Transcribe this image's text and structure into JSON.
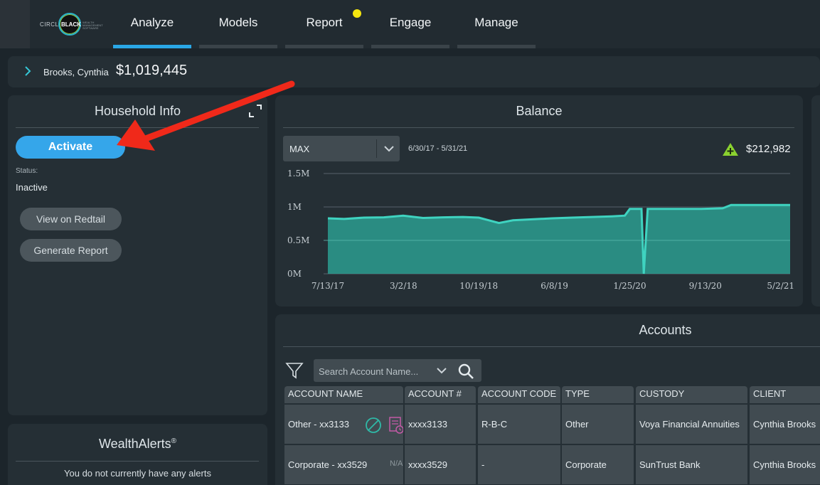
{
  "nav": {
    "logo": {
      "left": "CIRCLE",
      "mid": "BLACK",
      "tagline": "WEALTH MANAGEMENT SOFTWARE"
    },
    "tabs": [
      "Analyze",
      "Models",
      "Report",
      "Engage",
      "Manage"
    ],
    "active_tab": "Analyze",
    "notification_color": "#f5e60f"
  },
  "client": {
    "name": "Brooks, Cynthia",
    "total": "$1,019,445"
  },
  "household": {
    "title": "Household Info",
    "activate_label": "Activate",
    "status_label": "Status:",
    "status_value": "Inactive",
    "view_redtail_label": "View on Redtail",
    "generate_report_label": "Generate Report"
  },
  "wealth_alerts": {
    "title": "WealthAlerts",
    "trademark": "®",
    "message": "You do not currently have any alerts"
  },
  "balance": {
    "title": "Balance",
    "range_value": "MAX",
    "date_range": "6/30/17 - 5/31/21",
    "change_value": "$212,982",
    "change_direction": "up"
  },
  "chart_data": {
    "type": "area",
    "title": "Balance",
    "y_ticks": [
      "1.5M",
      "1M",
      "0.5M",
      "0M"
    ],
    "x_ticks": [
      "7/13/17",
      "3/2/18",
      "10/19/18",
      "6/8/19",
      "1/25/20",
      "9/13/20",
      "5/2/21"
    ],
    "ylim": [
      0,
      1500000
    ],
    "series": [
      {
        "x": [
          "7/13/17",
          "9/1/17",
          "11/1/17",
          "1/1/18",
          "3/1/18",
          "5/1/18",
          "7/1/18",
          "9/1/18",
          "10/19/18",
          "12/20/18",
          "2/1/19",
          "4/1/19",
          "6/1/19",
          "8/1/19",
          "10/1/19",
          "12/1/19",
          "1/10/20",
          "1/25/20",
          "3/1/20",
          "3/8/20",
          "3/20/20",
          "6/1/20",
          "9/1/20",
          "11/5/20",
          "12/1/20",
          "3/1/21",
          "5/31/21"
        ],
        "values": [
          830000,
          820000,
          840000,
          845000,
          870000,
          835000,
          845000,
          850000,
          840000,
          760000,
          800000,
          815000,
          830000,
          840000,
          850000,
          860000,
          870000,
          970000,
          970000,
          0,
          970000,
          970000,
          970000,
          980000,
          1030000,
          1030000,
          1030000
        ]
      }
    ],
    "grid": true,
    "colors": {
      "fill": "#2b9c8f",
      "line": "#3fd3c0"
    }
  },
  "accounts": {
    "title": "Accounts",
    "search_placeholder": "Search Account Name...",
    "columns": [
      "ACCOUNT NAME",
      "ACCOUNT #",
      "ACCOUNT CODE",
      "TYPE",
      "CUSTODY",
      "CLIENT"
    ],
    "rows": [
      {
        "name": "Other - xx3133",
        "number": "xxxx3133",
        "code": "R-B-C",
        "type": "Other",
        "custody": "Voya Financial Annuities",
        "client": "Cynthia Brooks",
        "note": ""
      },
      {
        "name": "Corporate - xx3529",
        "number": "xxxx3529",
        "code": "-",
        "type": "Corporate",
        "custody": "SunTrust Bank",
        "client": "Cynthia Brooks",
        "note": "N/A"
      }
    ]
  },
  "colors": {
    "accent": "#2aa7e6",
    "teal": "#35c7d6",
    "arrow": "#f0291a"
  }
}
